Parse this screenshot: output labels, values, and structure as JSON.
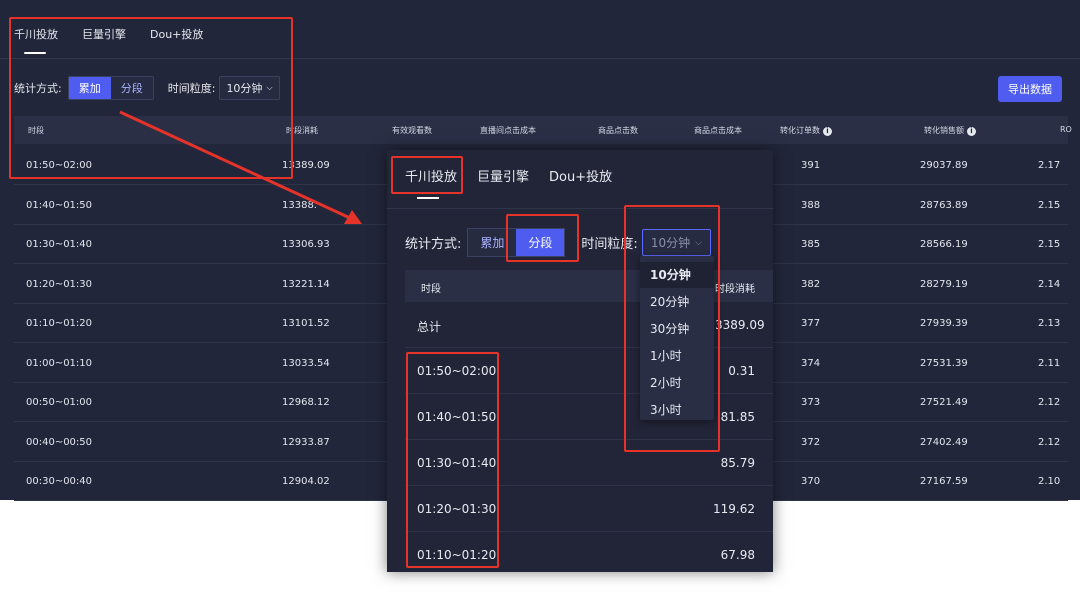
{
  "tabs": [
    "千川投放",
    "巨量引擎",
    "Dou+投放"
  ],
  "stat_label": "统计方式:",
  "seg_options": [
    "累加",
    "分段"
  ],
  "granularity_label": "时间粒度:",
  "granularity_value": "10分钟",
  "export_label": "导出数据",
  "bg_table": {
    "headers": [
      "时段",
      "时段消耗",
      "有效观看数",
      "直播间点击成本",
      "商品点击数",
      "商品点击成本",
      "转化订单数",
      "转化销售额",
      "RO"
    ],
    "rows": [
      [
        "01:50~02:00",
        "13389.09",
        "391",
        "29037.89",
        "2.17"
      ],
      [
        "01:40~01:50",
        "13388.",
        "388",
        "28763.89",
        "2.15"
      ],
      [
        "01:30~01:40",
        "13306.93",
        "385",
        "28566.19",
        "2.15"
      ],
      [
        "01:20~01:30",
        "13221.14",
        "382",
        "28279.19",
        "2.14"
      ],
      [
        "01:10~01:20",
        "13101.52",
        "377",
        "27939.39",
        "2.13"
      ],
      [
        "01:00~01:10",
        "13033.54",
        "374",
        "27531.39",
        "2.11"
      ],
      [
        "00:50~01:00",
        "12968.12",
        "373",
        "27521.49",
        "2.12"
      ],
      [
        "00:40~00:50",
        "12933.87",
        "372",
        "27402.49",
        "2.12"
      ],
      [
        "00:30~00:40",
        "12904.02",
        "370",
        "27167.59",
        "2.10"
      ]
    ]
  },
  "zoom": {
    "granularity_placeholder": "10分钟",
    "headers": [
      "时段",
      "时段消耗"
    ],
    "total_label": "总计",
    "total_value": "3389.09",
    "rows": [
      [
        "01:50~02:00",
        "0.31"
      ],
      [
        "01:40~01:50",
        "81.85"
      ],
      [
        "01:30~01:40",
        "85.79"
      ],
      [
        "01:20~01:30",
        "119.62"
      ],
      [
        "01:10~01:20",
        "67.98"
      ]
    ],
    "dropdown_options": [
      "10分钟",
      "20分钟",
      "30分钟",
      "1小时",
      "2小时",
      "3小时"
    ]
  },
  "colors": {
    "annotation": "#e6332a",
    "accent": "#4e5df0",
    "panel": "#22263a"
  }
}
